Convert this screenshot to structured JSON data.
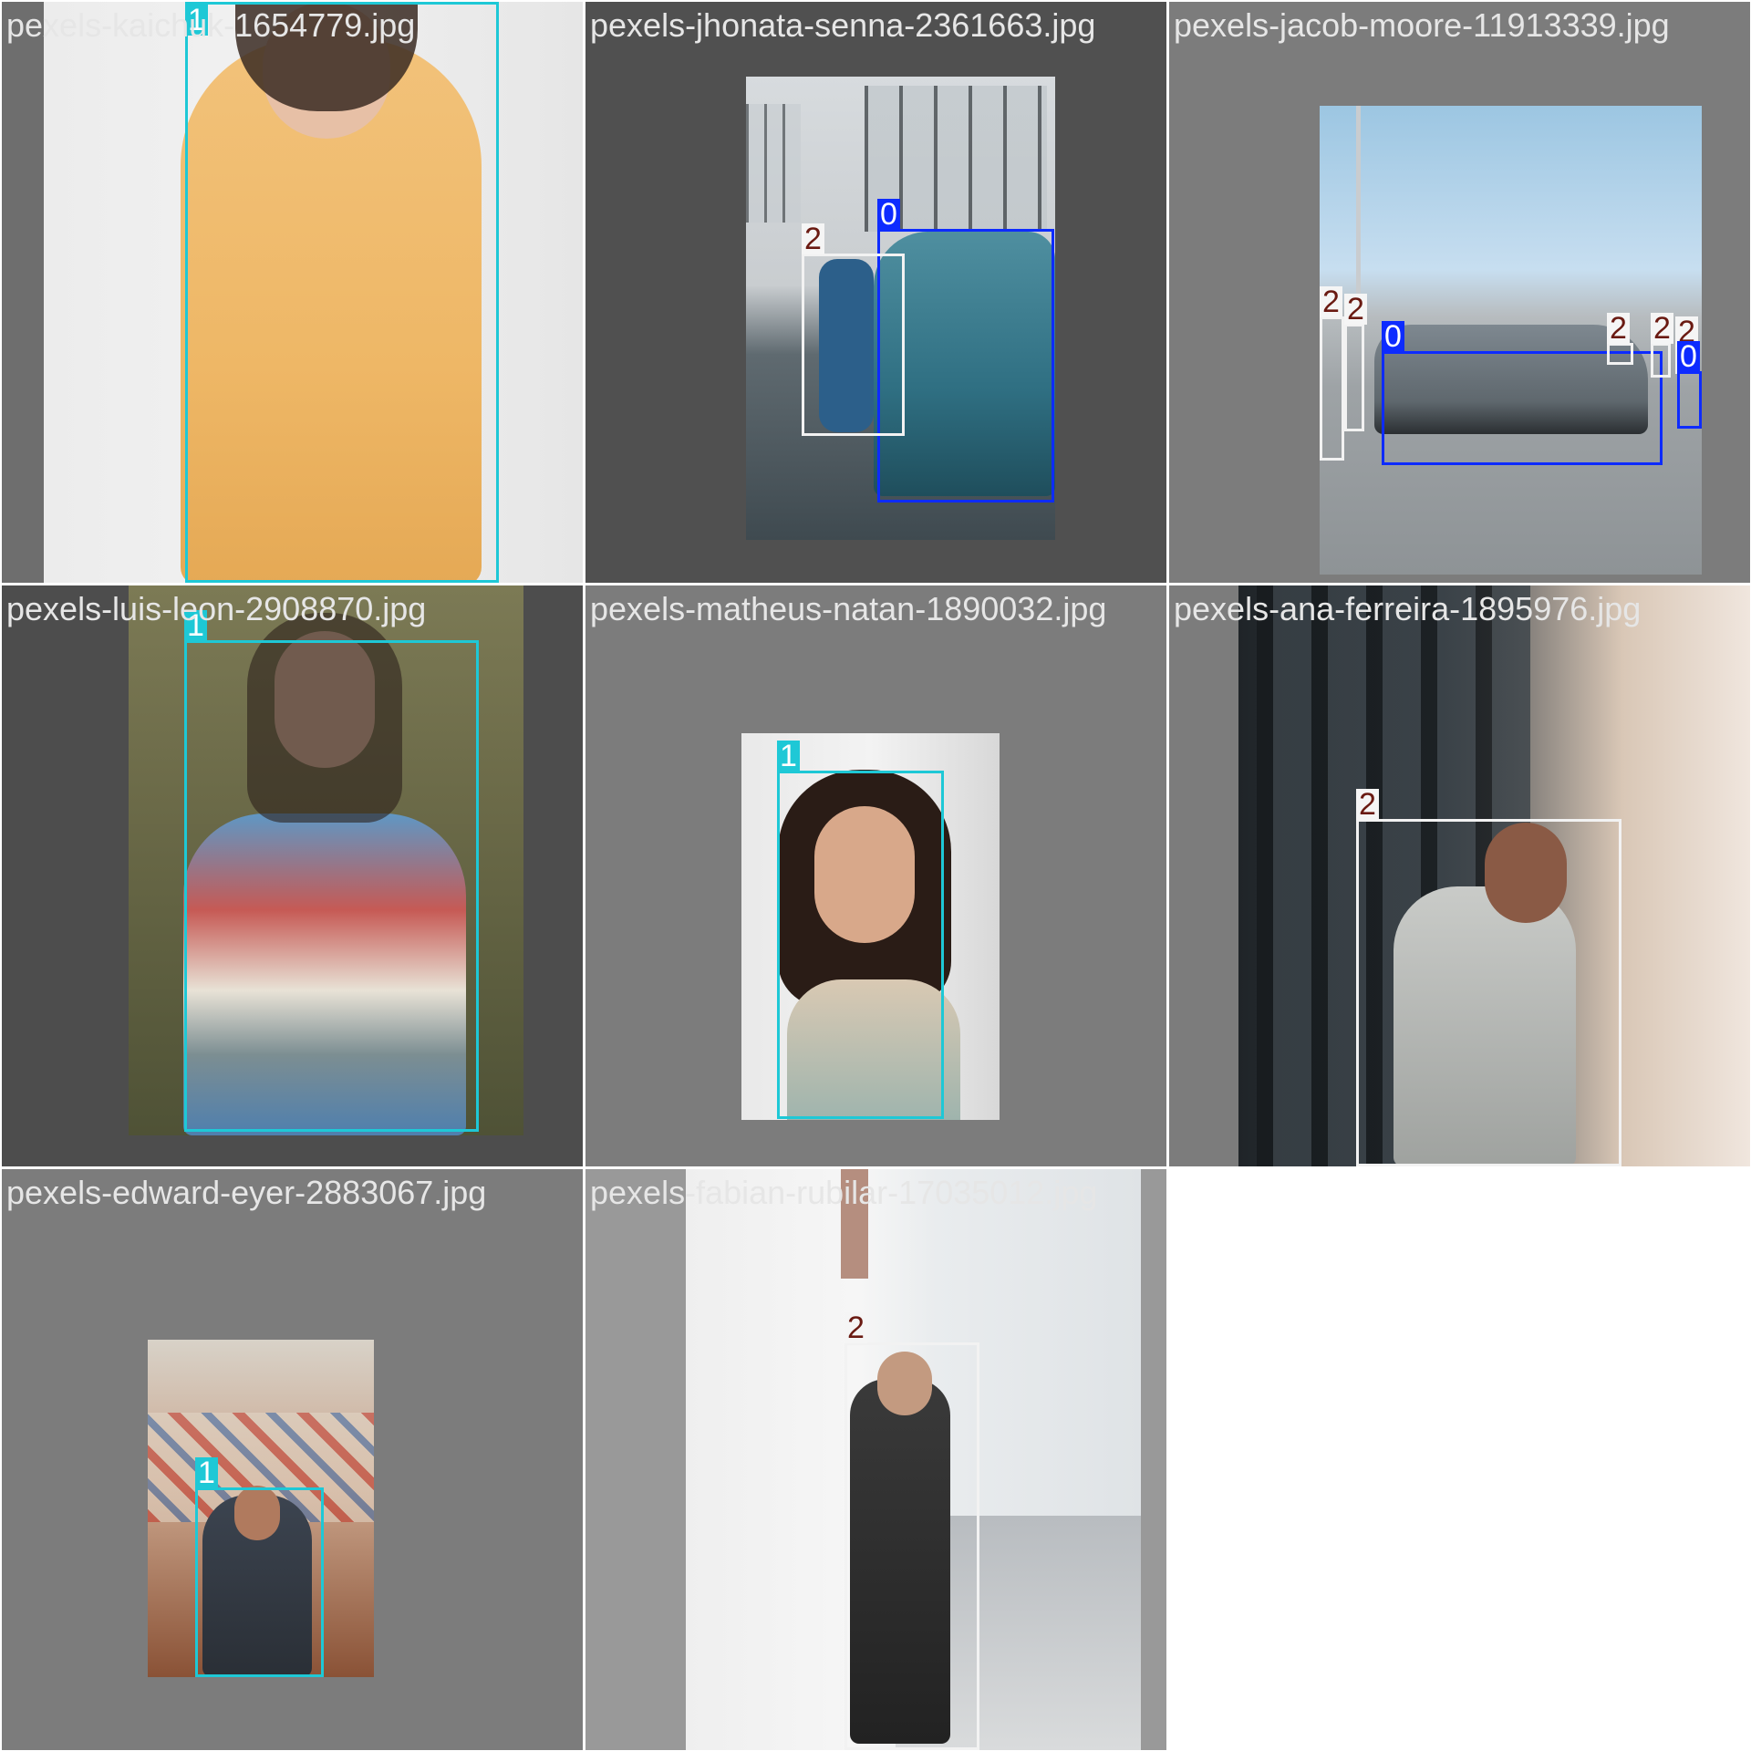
{
  "tiles": [
    {
      "filename": "pexels-kaichuk-1654779.jpg",
      "boxes": [
        {
          "cls": "1"
        }
      ]
    },
    {
      "filename": "pexels-jhonata-senna-2361663.jpg",
      "boxes": [
        {
          "cls": "0"
        },
        {
          "cls": "2"
        }
      ]
    },
    {
      "filename": "pexels-jacob-moore-11913339.jpg",
      "boxes": [
        {
          "cls": "2"
        },
        {
          "cls": "2"
        },
        {
          "cls": "0"
        },
        {
          "cls": "2"
        },
        {
          "cls": "2"
        },
        {
          "cls": "2"
        },
        {
          "cls": "0"
        }
      ]
    },
    {
      "filename": "pexels-luis-leon-2908870.jpg",
      "boxes": [
        {
          "cls": "1"
        }
      ]
    },
    {
      "filename": "pexels-matheus-natan-1890032.jpg",
      "boxes": [
        {
          "cls": "1"
        }
      ]
    },
    {
      "filename": "pexels-ana-ferreira-1895976.jpg",
      "boxes": [
        {
          "cls": "2"
        }
      ]
    },
    {
      "filename": "pexels-edward-eyer-2883067.jpg",
      "boxes": [
        {
          "cls": "1"
        }
      ]
    },
    {
      "filename": "pexels-fabian-rubilar-17035012.jpg",
      "boxes": [
        {
          "cls": "2"
        }
      ]
    }
  ],
  "colors": {
    "class_0": "#0d2bff",
    "class_1": "#1ec8d6",
    "class_2": "#f2f2f2",
    "class_2_text": "#6a1a12"
  }
}
